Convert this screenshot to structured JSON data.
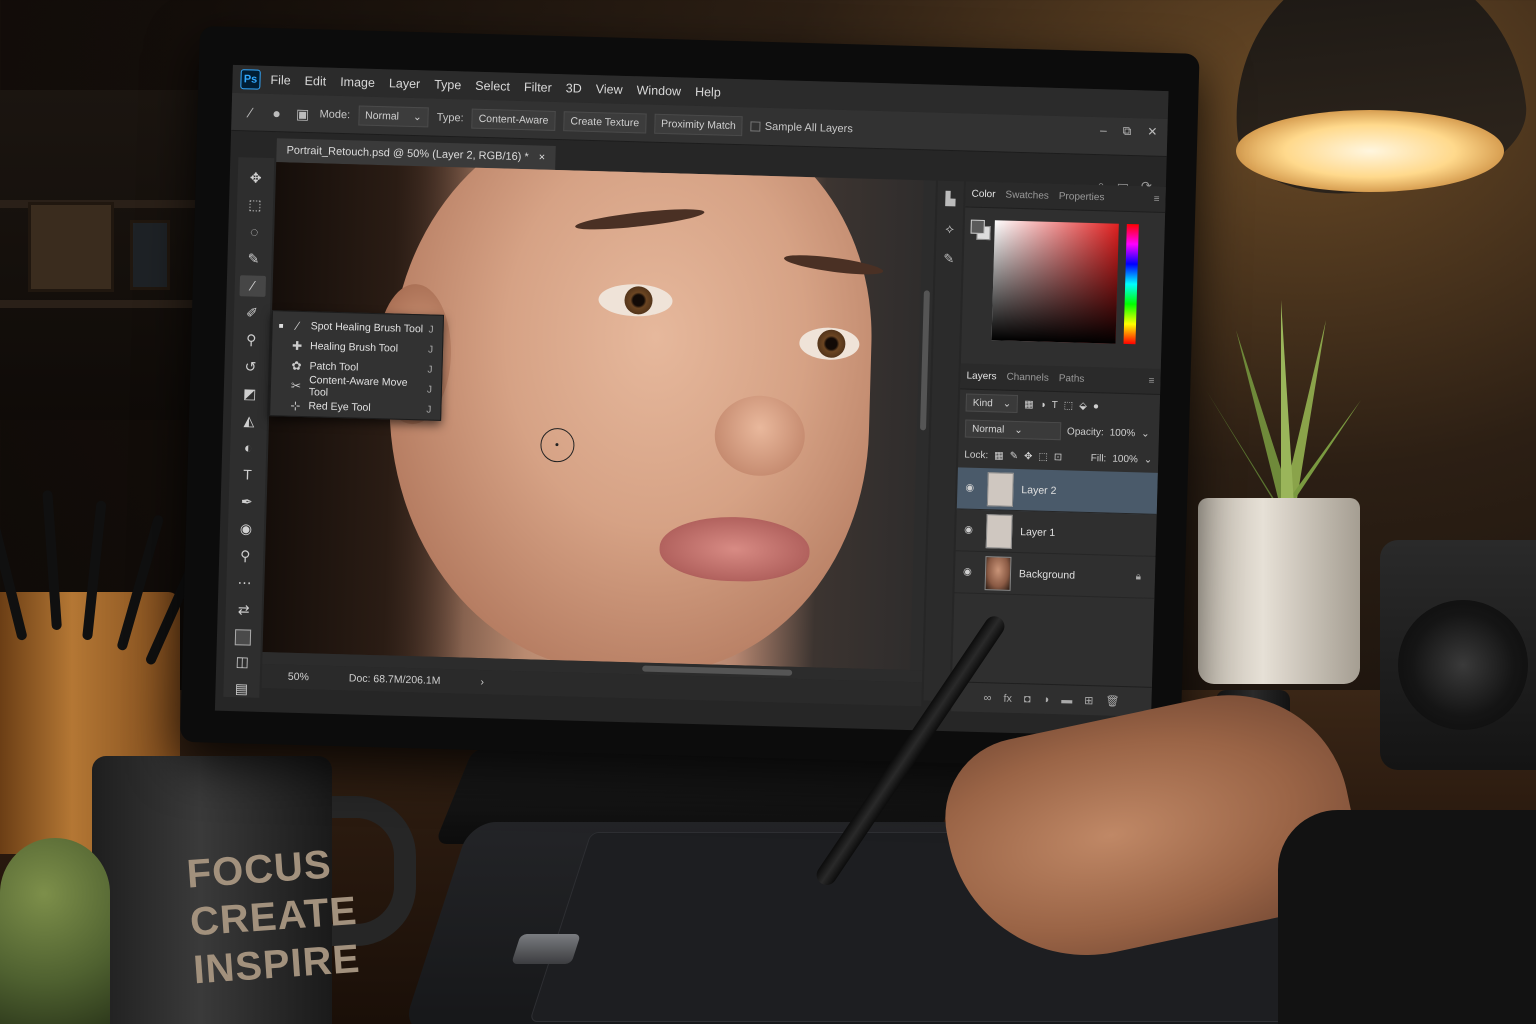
{
  "app": {
    "logo": "Ps",
    "menu": [
      "File",
      "Edit",
      "Image",
      "Layer",
      "Type",
      "Select",
      "Filter",
      "3D",
      "View",
      "Window",
      "Help"
    ]
  },
  "options_bar": {
    "mode_label": "Mode:",
    "mode_value": "Normal",
    "type_label": "Type:",
    "type_options": [
      "Content-Aware",
      "Create Texture",
      "Proximity Match"
    ],
    "sample_all_layers": "Sample All Layers"
  },
  "window_controls": [
    "–",
    "⧉",
    "✕"
  ],
  "document": {
    "tab_title": "Portrait_Retouch.psd @ 50% (Layer 2, RGB/16) *",
    "close": "×",
    "zoom": "50%",
    "doc_info": "Doc: 68.7M/206.1M"
  },
  "tool_flyout": [
    {
      "icon": "spot-healing-icon",
      "label": "Spot Healing Brush Tool",
      "shortcut": "J",
      "selected": true
    },
    {
      "icon": "healing-brush-icon",
      "label": "Healing Brush Tool",
      "shortcut": "J",
      "selected": false
    },
    {
      "icon": "patch-icon",
      "label": "Patch Tool",
      "shortcut": "J",
      "selected": false
    },
    {
      "icon": "content-aware-move-icon",
      "label": "Content-Aware Move Tool",
      "shortcut": "J",
      "selected": false
    },
    {
      "icon": "red-eye-icon",
      "label": "Red Eye Tool",
      "shortcut": "J",
      "selected": false
    }
  ],
  "color_panel": {
    "tabs": [
      "Color",
      "Swatches",
      "Properties"
    ],
    "active_tab": "Color"
  },
  "layers_panel": {
    "tabs": [
      "Layers",
      "Channels",
      "Paths"
    ],
    "active_tab": "Layers",
    "filter_label": "Kind",
    "blend_mode": "Normal",
    "opacity_label": "Opacity:",
    "opacity_value": "100%",
    "lock_label": "Lock:",
    "fill_label": "Fill:",
    "fill_value": "100%",
    "layers": [
      {
        "name": "Layer 2",
        "selected": true,
        "locked": false
      },
      {
        "name": "Layer 1",
        "selected": false,
        "locked": false
      },
      {
        "name": "Background",
        "selected": false,
        "locked": true
      }
    ]
  },
  "mug": {
    "lines": [
      "FOCUS",
      "CREATE",
      "INSPIRE"
    ]
  },
  "colors": {
    "ps_blue": "#31a8ff",
    "selected_layer": "#4a5a6a",
    "ui_dark": "#262626"
  }
}
